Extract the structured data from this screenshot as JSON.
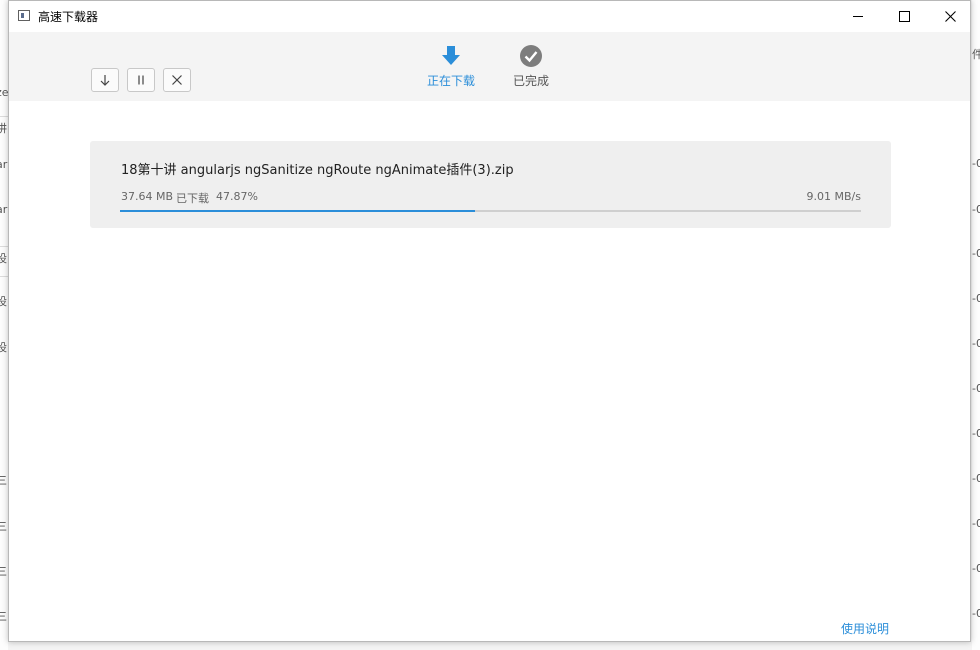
{
  "window": {
    "title": "高速下载器"
  },
  "toolbar": {
    "buttons": [
      {
        "name": "download",
        "icon": "arrow-down-icon"
      },
      {
        "name": "pause",
        "icon": "pause-icon"
      },
      {
        "name": "cancel",
        "icon": "close-icon"
      }
    ]
  },
  "tabs": {
    "downloading": {
      "label": "正在下载",
      "icon": "download-arrow-icon",
      "active": true
    },
    "completed": {
      "label": "已完成",
      "icon": "check-circle-icon",
      "active": false
    }
  },
  "downloads": [
    {
      "name": "18第十讲 angularjs ngSanitize ngRoute ngAnimate插件(3).zip",
      "size": "37.64 MB",
      "status": "已下载",
      "percent_text": "47.87%",
      "progress": 0.4787,
      "speed": "9.01 MB/s"
    }
  ],
  "footer": {
    "help_link": "使用说明"
  },
  "background": {
    "left_glyphs": [
      "ze",
      "讲",
      "ar",
      "ar",
      "设",
      "设",
      "设",
      "-",
      "-",
      "三",
      "三",
      "三",
      "三"
    ],
    "right_glyphs": [
      "件",
      "-0",
      "-0",
      "-0",
      "-0",
      "-0",
      "-0",
      "-0",
      "-0",
      "-0",
      "-0",
      "-0",
      "-0"
    ]
  },
  "colors": {
    "accent": "#2b8ed9",
    "toolbar_bg": "#f4f4f4",
    "card_bg": "#efefef"
  }
}
